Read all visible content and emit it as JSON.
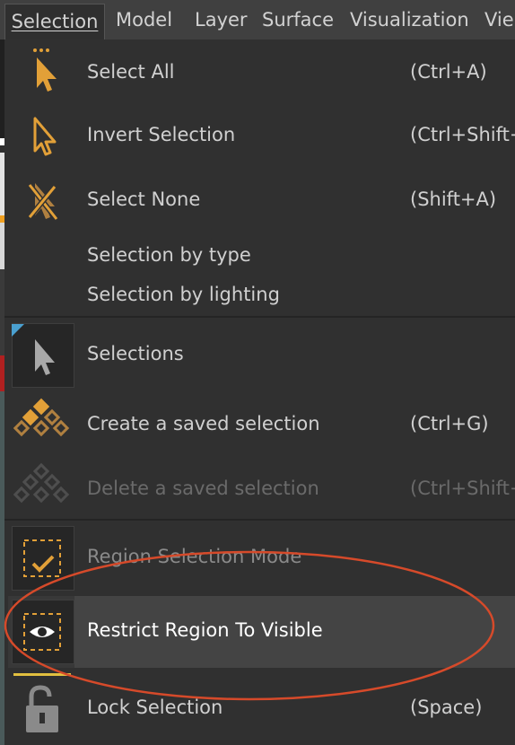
{
  "menubar": {
    "items": [
      {
        "label": "Selection",
        "active": true
      },
      {
        "label": "Model"
      },
      {
        "label": "Layer"
      },
      {
        "label": "Surface"
      },
      {
        "label": "Visualization"
      },
      {
        "label": "Vie"
      }
    ]
  },
  "menu": {
    "items": [
      {
        "label": "Select All",
        "shortcut": "(Ctrl+A)",
        "icon": "select-all-icon"
      },
      {
        "label": "Invert Selection",
        "shortcut": "(Ctrl+Shift+",
        "icon": "invert-selection-icon"
      },
      {
        "label": "Select None",
        "shortcut": "(Shift+A)",
        "icon": "select-none-icon"
      },
      {
        "label": "Selection by type"
      },
      {
        "label": "Selection by lighting"
      },
      {
        "label": "Selections",
        "icon": "selections-cursor-icon",
        "submenu": true
      },
      {
        "label": "Create a saved selection",
        "shortcut": "(Ctrl+G)",
        "icon": "create-saved-selection-icon"
      },
      {
        "label": "Delete a saved selection",
        "shortcut": "(Ctrl+Shift+",
        "icon": "delete-saved-selection-icon",
        "disabled": true
      },
      {
        "label": "Region Selection Mode",
        "icon": "region-selection-checked-icon",
        "checked": true
      },
      {
        "label": "Restrict Region To Visible",
        "icon": "region-eye-icon",
        "highlighted": true
      },
      {
        "label": "Lock Selection",
        "shortcut": "(Space)",
        "icon": "lock-open-icon"
      }
    ]
  },
  "colors": {
    "menubar_bg": "#404040",
    "menu_bg": "#303030",
    "text": "#d0d0d0",
    "disabled_text": "#6a6a6a",
    "accent": "#e2a038",
    "highlight_bg": "#444444",
    "annotation": "#d64a2a"
  }
}
